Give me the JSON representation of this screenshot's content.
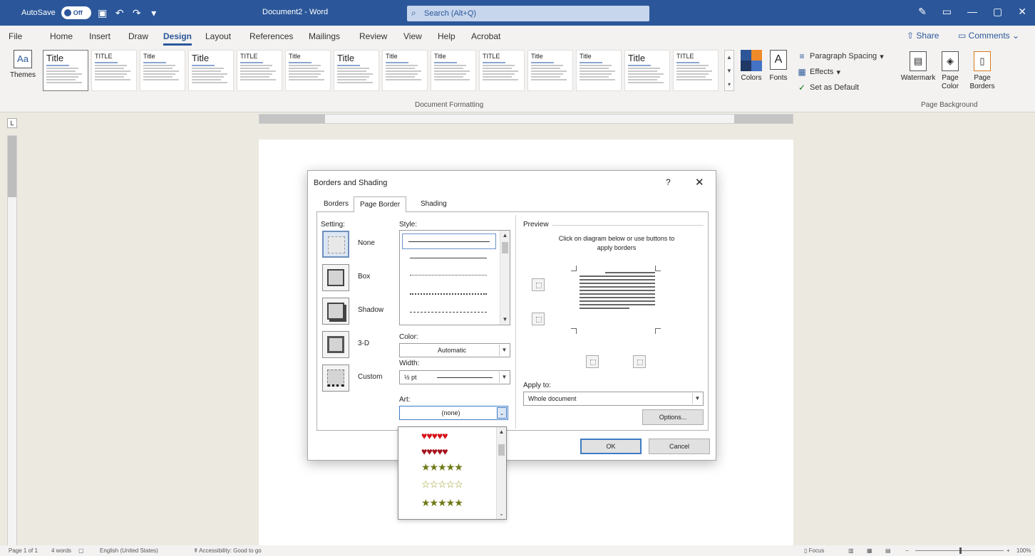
{
  "titlebar": {
    "autosave_label": "AutoSave",
    "autosave_state": "Off",
    "doc_title": "Document2 - Word",
    "search_placeholder": "Search (Alt+Q)",
    "accent": "#2b579a"
  },
  "menu": {
    "tabs": [
      "File",
      "Home",
      "Insert",
      "Draw",
      "Design",
      "Layout",
      "References",
      "Mailings",
      "Review",
      "View",
      "Help",
      "Acrobat"
    ],
    "active": "Design",
    "share_label": "Share",
    "comments_label": "Comments"
  },
  "ribbon": {
    "themes_label": "Themes",
    "style_thumbs": [
      "Title",
      "TITLE",
      "Title",
      "Title",
      "TITLE",
      "Title",
      "Title",
      "Title",
      "Title",
      "TITLE",
      "Title",
      "Title",
      "Title",
      "TITLE"
    ],
    "document_formatting_label": "Document Formatting",
    "colors_label": "Colors",
    "fonts_label": "Fonts",
    "paragraph_spacing_label": "Paragraph Spacing",
    "effects_label": "Effects",
    "set_default_label": "Set as Default",
    "watermark_label": "Watermark",
    "page_color_label": "Page Color",
    "page_borders_label": "Page Borders",
    "page_background_label": "Page Background"
  },
  "dialog": {
    "title": "Borders and Shading",
    "help": "?",
    "close": "✕",
    "tabs": [
      "Borders",
      "Page Border",
      "Shading"
    ],
    "active_tab": "Page Border",
    "setting_label": "Setting:",
    "settings": [
      "None",
      "Box",
      "Shadow",
      "3-D",
      "Custom"
    ],
    "selected_setting": "None",
    "style_label": "Style:",
    "color_label": "Color:",
    "color_value": "Automatic",
    "width_label": "Width:",
    "width_value": "½ pt",
    "art_label": "Art:",
    "art_value": "(none)",
    "preview_label": "Preview",
    "preview_hint": "Click on diagram below or use buttons to apply borders",
    "apply_to_label": "Apply to:",
    "apply_to_value": "Whole document",
    "options_label": "Options...",
    "ok_label": "OK",
    "cancel_label": "Cancel"
  },
  "art_options": [
    "♥♥♥♥♥",
    "♥♥♥♥♥",
    "★★★★★",
    "☆☆☆☆☆",
    "★★★★★"
  ],
  "statusbar": {
    "page": "Page 1 of 1",
    "words": "4 words",
    "language": "English (United States)",
    "accessibility": "Accessibility: Good to go",
    "focus": "Focus",
    "zoom": "100%"
  }
}
